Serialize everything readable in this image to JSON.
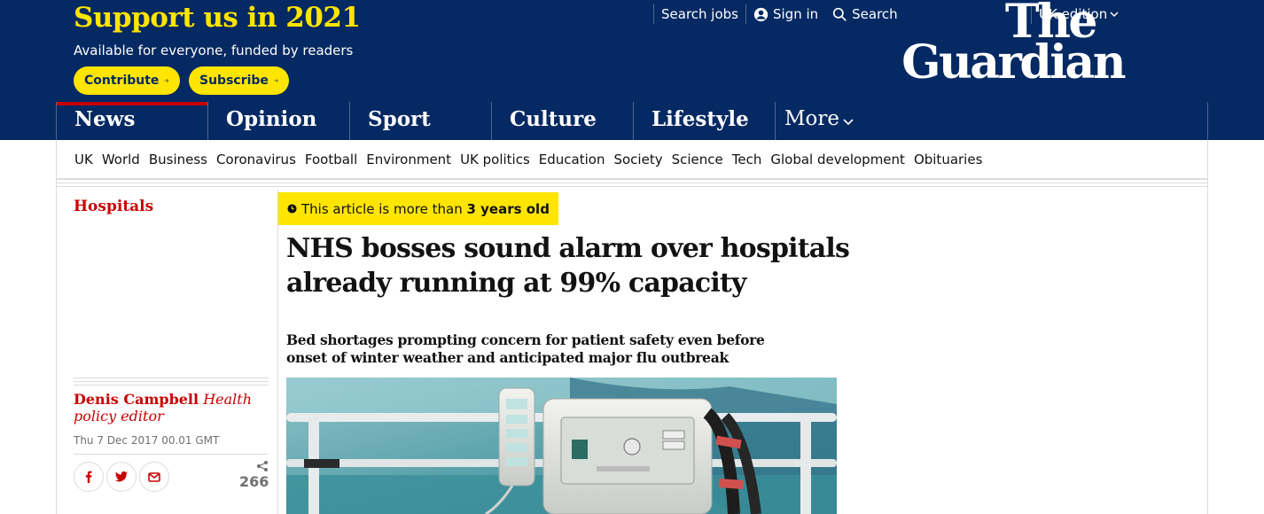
{
  "header": {
    "support_title": "Support us in 2021",
    "support_sub": "Available for everyone, funded by readers",
    "contribute_label": "Contribute",
    "subscribe_label": "Subscribe",
    "search_jobs": "Search jobs",
    "sign_in": "Sign in",
    "search": "Search",
    "edition": "UK edition",
    "logo_line1": "The",
    "logo_line2": "Guardian"
  },
  "pillars": [
    {
      "label": "News",
      "active": true
    },
    {
      "label": "Opinion"
    },
    {
      "label": "Sport"
    },
    {
      "label": "Culture"
    },
    {
      "label": "Lifestyle"
    }
  ],
  "more_label": "More",
  "subnav": [
    "UK",
    "World",
    "Business",
    "Coronavirus",
    "Football",
    "Environment",
    "UK politics",
    "Education",
    "Society",
    "Science",
    "Tech",
    "Global development",
    "Obituaries"
  ],
  "article": {
    "section": "Hospitals",
    "age_prefix": "This article is more than ",
    "age_value": "3 years old",
    "headline": "NHS bosses sound alarm over hospitals already running at 99% capacity",
    "standfirst": "Bed shortages prompting concern for patient safety even before onset of winter weather and anticipated major flu outbreak",
    "author": "Denis Campbell",
    "author_role": "Health policy editor",
    "date": "Thu 7 Dec 2017 00.01 GMT",
    "share_count": "266"
  },
  "colors": {
    "brand_blue": "#052962",
    "accent_yellow": "#ffe500",
    "news_red": "#c70000"
  },
  "icons": [
    "arrow-right-icon",
    "user-icon",
    "search-icon",
    "chevron-down-icon",
    "clock-icon",
    "facebook-icon",
    "twitter-icon",
    "email-icon",
    "share-icon"
  ]
}
